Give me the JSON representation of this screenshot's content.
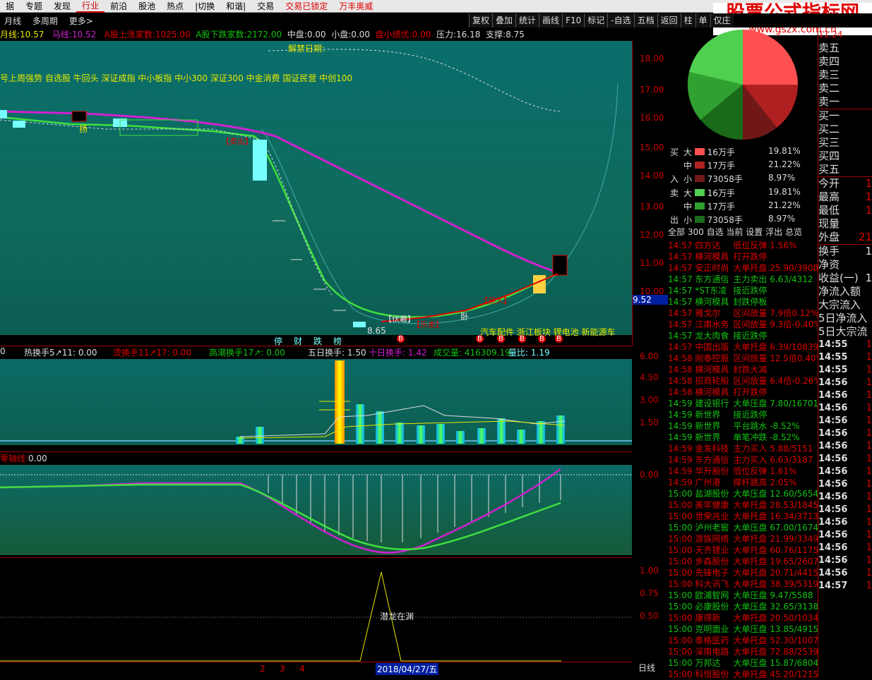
{
  "menu": {
    "items": [
      "据",
      "专题",
      "发现",
      "行业",
      "前沿",
      "股池",
      "热点",
      "|切换",
      "和谐|",
      "交易"
    ],
    "locked": "交易已锁定",
    "brand": "万丰奥威"
  },
  "row2": {
    "left": [
      "月线",
      "多周期",
      "更多>"
    ],
    "buttons": [
      "复权",
      "叠加",
      "统计",
      "画线",
      "F10",
      "标记",
      "-自选",
      "五档",
      "返回",
      "柱",
      "单",
      "仅庄"
    ]
  },
  "info": {
    "yue_label": "月线:",
    "yue_value": "10.57",
    "ma_label": "马线:",
    "ma_value": "10.52",
    "up_label": "A股上涨家数:",
    "up_value": "1025.00",
    "down_label": "A股下跌家数:",
    "down_value": "2172.00",
    "mid_label": "中盘:",
    "mid_value": "0.00",
    "small_label": "小盘:",
    "small_value": "0.00",
    "pan_label": "盘小绩优:",
    "pan_value": "0.00",
    "press_label": "压力:",
    "press_value": "16.18",
    "support_label": "支撑:",
    "support_value": "8.75"
  },
  "main": {
    "jiejin": "解禁日期:",
    "indices": "号上周强势   自选股 牛回头   深证成指 中小板指 中小300 深证300 中金消费 国证民营 中创100",
    "concepts": "汽车配件 浙江板块 锂电池 新能源车",
    "low_label": "8.65",
    "yang": "扬",
    "wo": "卧",
    "tags": [
      "停",
      "财",
      "跌",
      "榜"
    ],
    "b_marks": [
      "B",
      "B",
      "B",
      "B",
      "B",
      "B"
    ],
    "price_label": "9.52",
    "signals": [
      "【卖出】",
      "【伏羲】",
      "【乐卖】",
      "【买入】"
    ]
  },
  "axis_main": [
    "18.00",
    "17.00",
    "16.00",
    "15.00",
    "14.00",
    "13.00",
    "12.00",
    "11.00",
    "10.00"
  ],
  "vol": {
    "hot": "热换手5↗11:",
    "hot_v": "0.00",
    "hot2": "烫换手11↗17:",
    "hot2_v": "0.00",
    "climax": "高潮换手17↗:",
    "climax_v": "0.00",
    "five": "五日换手:",
    "five_v": "1.50",
    "ten": "十日换手:",
    "ten_v": "1.42",
    "cj": "成交量:",
    "cj_v": "416309.19",
    "lb": "量比:",
    "lb_v": "1.19",
    "zero": "0",
    "axis": [
      "6.00",
      "4.50",
      "3.00",
      "1.50"
    ]
  },
  "zero": {
    "label": "零轴线:",
    "value": "0.00",
    "axis": [
      "0.00"
    ]
  },
  "bottom": {
    "label": "潜龙在渊",
    "axis": [
      "1.00",
      "0.75",
      "0.50"
    ]
  },
  "datestrip": {
    "marks": [
      "2",
      "3",
      "4"
    ],
    "date": "2018/04/27/五",
    "period": "日线"
  },
  "flow": {
    "buy_side": [
      "买",
      "入"
    ],
    "sell_side": [
      "卖",
      "出"
    ],
    "rows": [
      {
        "s": "大",
        "v": "16万手",
        "p": "19.81%"
      },
      {
        "s": "中",
        "v": "17万手",
        "p": "21.22%"
      },
      {
        "s": "小",
        "v": "73058手",
        "p": "8.97%"
      },
      {
        "s": "大",
        "v": "16万手",
        "p": "19.81%"
      },
      {
        "s": "中",
        "v": "17万手",
        "p": "21.22%"
      },
      {
        "s": "小",
        "v": "73058手",
        "p": "8.97%"
      }
    ]
  },
  "tabs": [
    "全部",
    "300",
    "自选",
    "当前",
    "设置",
    "浮出",
    "总览"
  ],
  "ticker": [
    {
      "t": "14:57",
      "n": "四方达",
      "a": "低位反弹 1.56%",
      "g": false
    },
    {
      "t": "14:57",
      "n": "横河模具",
      "a": "打开跌停",
      "g": false
    },
    {
      "t": "14:57",
      "n": "安正时尚",
      "a": "大单托盘 25.90/3908",
      "g": false
    },
    {
      "t": "14:57",
      "n": "东方通信",
      "a": "主力卖出 6.63/4312",
      "g": true
    },
    {
      "t": "14:57",
      "n": "*ST东凌",
      "a": "接近跌停",
      "g": true
    },
    {
      "t": "14:57",
      "n": "横河模具",
      "a": "封跌停板",
      "g": true
    },
    {
      "t": "14:57",
      "n": "雅戈尔",
      "a": "区间放量 7.9倍0.12%",
      "g": false
    },
    {
      "t": "14:57",
      "n": "江南水务",
      "a": "区间放量 9.3倍-0.40%",
      "g": false
    },
    {
      "t": "14:57",
      "n": "龙大肉食",
      "a": "接近跌停",
      "g": true
    },
    {
      "t": "14:57",
      "n": "中国出版",
      "a": "大单托盘 6.39/10839",
      "g": false
    },
    {
      "t": "14:58",
      "n": "刚泰控股",
      "a": "区间放量 12.5倍0.40%",
      "g": false
    },
    {
      "t": "14:58",
      "n": "横河模具",
      "a": "封跌大减",
      "g": false
    },
    {
      "t": "14:58",
      "n": "招商轮船",
      "a": "区间放量 6.4倍-0.26%",
      "g": false
    },
    {
      "t": "14:58",
      "n": "横河模具",
      "a": "打开跌停",
      "g": false
    },
    {
      "t": "14:59",
      "n": "建设银行",
      "a": "大单压盘 7.80/16701",
      "g": true
    },
    {
      "t": "14:59",
      "n": "新世界",
      "a": "接近跌停",
      "g": true
    },
    {
      "t": "14:59",
      "n": "新世界",
      "a": "平台跳水 -8.52%",
      "g": true
    },
    {
      "t": "14:59",
      "n": "新世界",
      "a": "单笔冲跌 -8.52%",
      "g": true
    },
    {
      "t": "14:59",
      "n": "金发科技",
      "a": "主力买入 5.88/5151",
      "g": false
    },
    {
      "t": "14:59",
      "n": "东方通信",
      "a": "主力买入 6.63/3187",
      "g": false
    },
    {
      "t": "14:59",
      "n": "华升股份",
      "a": "低位反弹 1.61%",
      "g": false
    },
    {
      "t": "14:59",
      "n": "广州港",
      "a": "撑杆跳高 2.05%",
      "g": false
    },
    {
      "t": "15:00",
      "n": "盐湖股份",
      "a": "大单压盘 12.60/5654",
      "g": true
    },
    {
      "t": "15:00",
      "n": "美年健康",
      "a": "大单托盘 28.53/1845",
      "g": false
    },
    {
      "t": "15:00",
      "n": "世荣兆业",
      "a": "大单托盘 16.34/3713",
      "g": false
    },
    {
      "t": "15:00",
      "n": "泸州老窖",
      "a": "大单压盘 67.00/1674",
      "g": true
    },
    {
      "t": "15:00",
      "n": "游族网络",
      "a": "大单托盘 21.99/3349",
      "g": false
    },
    {
      "t": "15:00",
      "n": "天齐锂业",
      "a": "大单托盘 60.76/1175",
      "g": false
    },
    {
      "t": "15:00",
      "n": "步森股份",
      "a": "大单托盘 19.65/2607",
      "g": false
    },
    {
      "t": "15:00",
      "n": "先锋电子",
      "a": "大单托盘 20.71/4415",
      "g": false
    },
    {
      "t": "15:00",
      "n": "科大讯飞",
      "a": "大单托盘 38.39/5319",
      "g": false
    },
    {
      "t": "15:00",
      "n": "欧浦智网",
      "a": "大单压盘 9.47/5588",
      "g": true
    },
    {
      "t": "15:00",
      "n": "必康股份",
      "a": "大单压盘 32.65/3138",
      "g": true
    },
    {
      "t": "15:00",
      "n": "康得新",
      "a": "大单托盘 20.50/10343",
      "g": false
    },
    {
      "t": "15:00",
      "n": "克明面业",
      "a": "大单压盘 13.85/4915",
      "g": true
    },
    {
      "t": "15:00",
      "n": "泰格医药",
      "a": "大单托盘 52.30/1007",
      "g": false
    },
    {
      "t": "15:00",
      "n": "深南电路",
      "a": "大单托盘 72.88/2539",
      "g": false
    },
    {
      "t": "15:00",
      "n": "万邦达",
      "a": "大单压盘 15.87/6804",
      "g": true
    },
    {
      "t": "15:00",
      "n": "科恒股份",
      "a": "大单托盘 45.20/1215",
      "g": false
    }
  ],
  "quote": {
    "top": "11.24",
    "sell": [
      "卖五",
      "卖四",
      "卖三",
      "卖二",
      "卖一"
    ],
    "buy": [
      "买一",
      "买二",
      "买三",
      "买四",
      "买五"
    ],
    "stats": [
      "今开",
      "最高",
      "最低",
      "现量",
      "外盘"
    ],
    "stats_r": [
      "1",
      "1",
      "1",
      "",
      "21"
    ],
    "extra": [
      "换手",
      "净资",
      "收益(一)",
      "净流入额",
      "大宗流入",
      "5日净流入",
      "5日大宗流"
    ],
    "extra_r": [
      "1",
      "",
      "1"
    ],
    "times": [
      "14:55",
      "14:55",
      "14:55",
      "14:56",
      "14:56",
      "14:56",
      "14:56",
      "14:56",
      "14:56",
      "14:56",
      "14:56",
      "14:56",
      "14:56",
      "14:56",
      "14:56",
      "14:56",
      "14:56",
      "14:56",
      "14:56",
      "14:57"
    ],
    "time_r": [
      "1",
      "1",
      "1",
      "1",
      "1",
      "1",
      "1",
      "1",
      "1",
      "1",
      "1",
      "1",
      "1",
      "1",
      "1",
      "1",
      "1",
      "1",
      "1",
      "1"
    ]
  },
  "watermark": {
    "title": "股票公式指标网",
    "url": "www.gszx.com.cn"
  },
  "colors": {
    "ma_purple": "#d020d0",
    "ma_green": "#40e040",
    "up_red": "#e00000",
    "down_cyan": "#7ff",
    "grid_red": "#a00000"
  }
}
